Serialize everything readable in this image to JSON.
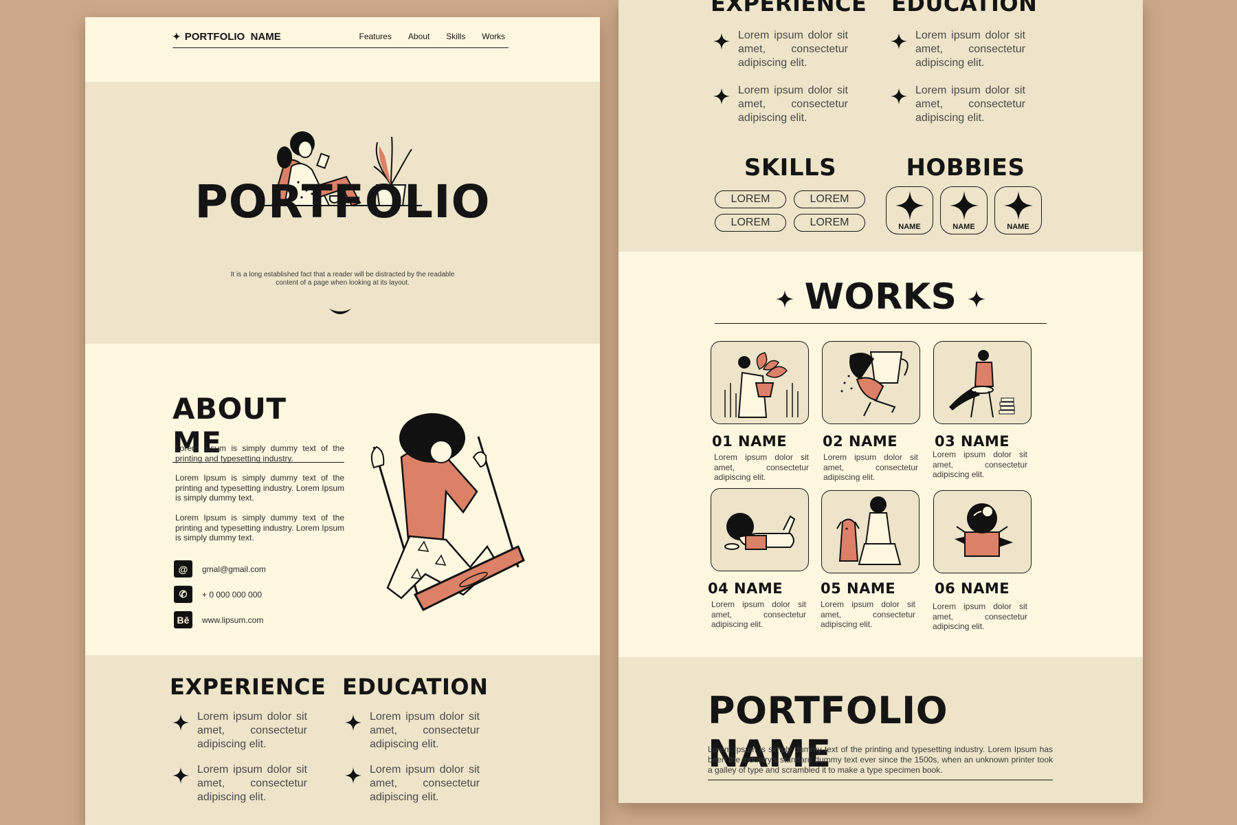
{
  "left_page": {
    "nav": {
      "brand": "PORTFOLIO  NAME",
      "links": [
        "Features",
        "About",
        "Skills",
        "Works"
      ]
    },
    "hero": {
      "title": "PORTFOLIO",
      "subtitle": "It is a long established fact that a reader will be distracted by the readable content of a page when looking at its layout."
    },
    "about": {
      "title": "ABOUT ME",
      "paragraphs": [
        "Lorem Ipsum is simply dummy text of the printing and typesetting industry.",
        "Lorem Ipsum is simply dummy text of the printing and typesetting industry. Lorem Ipsum is simply dummy text.",
        "Lorem Ipsum is simply dummy text of the printing and typesetting industry. Lorem Ipsum is simply dummy text."
      ],
      "contacts": [
        {
          "icon": "at-icon",
          "glyph": "@",
          "text": "gmal@gmail.com"
        },
        {
          "icon": "phone-icon",
          "glyph": "✆",
          "text": "+ 0 000 000 000"
        },
        {
          "icon": "behance-icon",
          "glyph": "Bē",
          "text": "www.lipsum.com"
        }
      ]
    },
    "experience": {
      "title": "EXPERIENCE",
      "items": [
        "Lorem ipsum dolor sit amet, consectetur adipiscing elit.",
        "Lorem ipsum dolor sit amet, consectetur adipiscing elit."
      ]
    },
    "education": {
      "title": "EDUCATION",
      "items": [
        "Lorem ipsum dolor sit amet, consectetur adipiscing elit.",
        "Lorem ipsum dolor sit amet, consectetur adipiscing elit."
      ]
    }
  },
  "right_page": {
    "experience": {
      "title": "EXPERIENCE",
      "items": [
        "Lorem ipsum dolor sit amet, consectetur adipiscing elit.",
        "Lorem ipsum dolor sit amet, consectetur adipiscing elit."
      ]
    },
    "education": {
      "title": "EDUCATION",
      "items": [
        "Lorem ipsum dolor sit amet, consectetur adipiscing elit.",
        "Lorem ipsum dolor sit amet, consectetur adipiscing elit."
      ]
    },
    "skills": {
      "title": "SKILLS",
      "pills": [
        "LOREM",
        "LOREM",
        "LOREM",
        "LOREM"
      ]
    },
    "hobbies": {
      "title": "HOBBIES",
      "items": [
        "NAME",
        "NAME",
        "NAME"
      ]
    },
    "works": {
      "title": "WORKS",
      "items": [
        {
          "name": "01  NAME",
          "desc": "Lorem ipsum dolor sit amet, consectetur adipiscing elit."
        },
        {
          "name": "02 NAME",
          "desc": "Lorem ipsum dolor sit amet, consectetur adipiscing elit."
        },
        {
          "name": "03 NAME",
          "desc": "Lorem ipsum dolor sit amet, consectetur adipiscing elit."
        },
        {
          "name": "04 NAME",
          "desc": "Lorem ipsum dolor sit amet, consectetur adipiscing elit."
        },
        {
          "name": "05 NAME",
          "desc": "Lorem ipsum dolor sit amet, consectetur adipiscing elit."
        },
        {
          "name": "06 NAME",
          "desc": "Lorem ipsum dolor sit amet, consectetur adipiscing elit."
        }
      ]
    },
    "footer": {
      "title": "PORTFOLIO NAME",
      "text": "Lorem Ipsum is simply dummy text of the printing and typesetting industry. Lorem Ipsum has been the industry's standard dummy text ever since the 1500s, when an unknown printer took a galley of type and scrambled it to make a type specimen book."
    }
  },
  "colors": {
    "background": "#cba98b",
    "cream": "#fdf7e0",
    "beige": "#ede4c9",
    "accent": "#dc8068",
    "ink": "#141414"
  }
}
